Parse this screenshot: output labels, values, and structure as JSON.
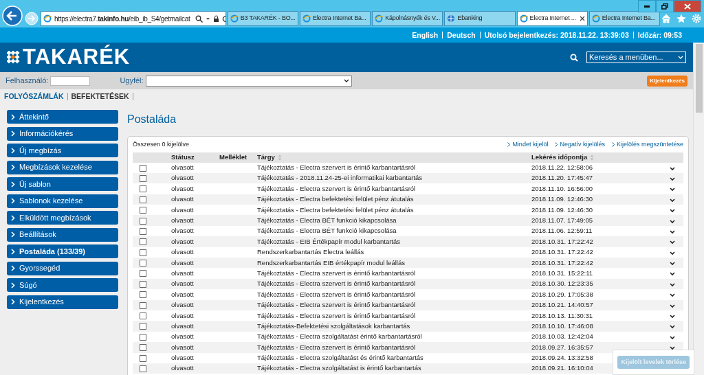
{
  "browser": {
    "address": "https://electra7.**takinfo.hu**/eib_ib_S4/getmailcat",
    "tabs": [
      {
        "label": "B3 TAKARÉK - BO...",
        "selected": false,
        "kind": "ie"
      },
      {
        "label": "Electra Internet Ba...",
        "selected": false,
        "kind": "ie"
      },
      {
        "label": "Kápolnásnyék és V...",
        "selected": false,
        "kind": "ie"
      },
      {
        "label": "Ebanking",
        "selected": false,
        "kind": "globe"
      },
      {
        "label": "Electra Internet ...",
        "selected": true,
        "kind": "ie"
      },
      {
        "label": "Electra Internet Ba...",
        "selected": false,
        "kind": "ie"
      }
    ]
  },
  "top_bar": {
    "links": [
      "English",
      "Deutsch"
    ],
    "last_login": "Utolsó bejelentkezés: 2018.11.22. 13:39:03",
    "timer": "Időzár: 09:53"
  },
  "header": {
    "logo": "TAKARÉK",
    "menu_search": "Keresés a menüben..."
  },
  "login_bar": {
    "user_label": "Felhasználó:",
    "client_label": "Ugyfél:",
    "logout": "Kijelentkezés"
  },
  "section_tabs": [
    {
      "label": "FOLYÓSZÁMLÁK",
      "selected": true
    },
    {
      "label": "BEFEKTETÉSEK",
      "selected": false
    }
  ],
  "sidebar": {
    "items": [
      {
        "label": "Áttekintő",
        "selected": false
      },
      {
        "label": "Információkérés",
        "selected": false
      },
      {
        "label": "Új megbízás",
        "selected": false
      },
      {
        "label": "Megbízások kezelése",
        "selected": false
      },
      {
        "label": "Új sablon",
        "selected": false
      },
      {
        "label": "Sablonok kezelése",
        "selected": false
      },
      {
        "label": "Elküldött megbízások",
        "selected": false
      },
      {
        "label": "Beállítások",
        "selected": false
      },
      {
        "label": "Postaláda (133/39)",
        "selected": true
      },
      {
        "label": "Gyorssegéd",
        "selected": false
      },
      {
        "label": "Súgó",
        "selected": false
      },
      {
        "label": "Kijelentkezés",
        "selected": false
      }
    ]
  },
  "mailbox": {
    "title": "Postaláda",
    "selection_count": "Összesen 0 kijelölve",
    "actions": [
      "Mindet kijelöl",
      "Negatív kijelölés",
      "Kijelölés megszüntetése"
    ],
    "columns": [
      {
        "label": "Státusz",
        "sortable": false
      },
      {
        "label": "Melléklet",
        "sortable": false
      },
      {
        "label": "Tárgy",
        "sortable": true
      },
      {
        "label": "Lekérés időpontja",
        "sortable": true
      }
    ],
    "rows": [
      {
        "checked": false,
        "status": "olvasott",
        "subject": "Tájékoztatás - Electra szervert is érintő karbantartásról",
        "time": "2018.11.22. 12:58:06"
      },
      {
        "checked": false,
        "status": "olvasott",
        "subject": "Tájékoztatás - 2018.11.24-25-ei informatikai karbantartás",
        "time": "2018.11.20. 17:45:47"
      },
      {
        "checked": false,
        "status": "olvasott",
        "subject": "Tájékoztatás - Electra szervert is érintő karbantartásról",
        "time": "2018.11.10. 16:56:00"
      },
      {
        "checked": false,
        "status": "olvasott",
        "subject": "Tájékoztatás - Electra befektetési felület pénz átutalás",
        "time": "2018.11.09. 12:46:30"
      },
      {
        "checked": false,
        "status": "olvasott",
        "subject": "Tájékoztatás - Electra befektetési felület pénz átutalás",
        "time": "2018.11.09. 12:46:30"
      },
      {
        "checked": false,
        "status": "olvasott",
        "subject": "Tájékoztatás - Electra BÉT funkció kikapcsolása",
        "time": "2018.11.07. 17:49:05"
      },
      {
        "checked": false,
        "status": "olvasott",
        "subject": "Tájékoztatás - Electra BÉT funkció kikapcsolása",
        "time": "2018.11.06. 12:59:11"
      },
      {
        "checked": false,
        "status": "olvasott",
        "subject": "Tájékoztatás - EIB Értékpapír modul karbantartás",
        "time": "2018.10.31. 17:22:42"
      },
      {
        "checked": false,
        "status": "olvasott",
        "subject": "Rendszerkarbantartás Electra leállás",
        "time": "2018.10.31. 17:22:42"
      },
      {
        "checked": false,
        "status": "olvasott",
        "subject": "Rendszerkarbantartás EIB értékpapír modul leállás",
        "time": "2018.10.31. 17:22:42"
      },
      {
        "checked": false,
        "status": "olvasott",
        "subject": "Tájékoztatás - Electra szervert is érintő karbantartásról",
        "time": "2018.10.31. 15:22:11"
      },
      {
        "checked": false,
        "status": "olvasott",
        "subject": "Tájékoztatás - Electra szervert is érintő karbantartásról",
        "time": "2018.10.30. 12:23:35"
      },
      {
        "checked": false,
        "status": "olvasott",
        "subject": "Tájékoztatás - Electra szervert is érintő karbantartásról",
        "time": "2018.10.29. 17:05:38"
      },
      {
        "checked": false,
        "status": "olvasott",
        "subject": "Tájékoztatás - Electra szervert is érintő karbantartásról",
        "time": "2018.10.21. 14:40:57"
      },
      {
        "checked": false,
        "status": "olvasott",
        "subject": "Tájékoztatás - Electra szervert is érintő karbantartásról",
        "time": "2018.10.13. 11:30:31"
      },
      {
        "checked": false,
        "status": "olvasott",
        "subject": "Tájékoztatás-Befektetési szolgáltatások karbantartás",
        "time": "2018.10.10. 17:46:08"
      },
      {
        "checked": false,
        "status": "olvasott",
        "subject": "Tájékoztatás - Electra szolgáltatást érintő karbantartásról",
        "time": "2018.10.03. 12:42:04"
      },
      {
        "checked": false,
        "status": "olvasott",
        "subject": "Tájékoztatás - Electra szervert is érintő karbantartásról",
        "time": "2018.09.27. 16:35:57"
      },
      {
        "checked": false,
        "status": "olvasott",
        "subject": "Tájékoztatás - Electra szolgáltatást és érintő karbantartás",
        "time": "2018.09.24. 13:32:58"
      },
      {
        "checked": false,
        "status": "olvasott",
        "subject": "Tájékoztatás - Electra szolgáltatást is érintő karbantartás",
        "time": "2018.09.21. 16:10:04"
      }
    ],
    "delete_button": {
      "label": "Kijelölt levelek törlése",
      "disabled": true
    }
  }
}
